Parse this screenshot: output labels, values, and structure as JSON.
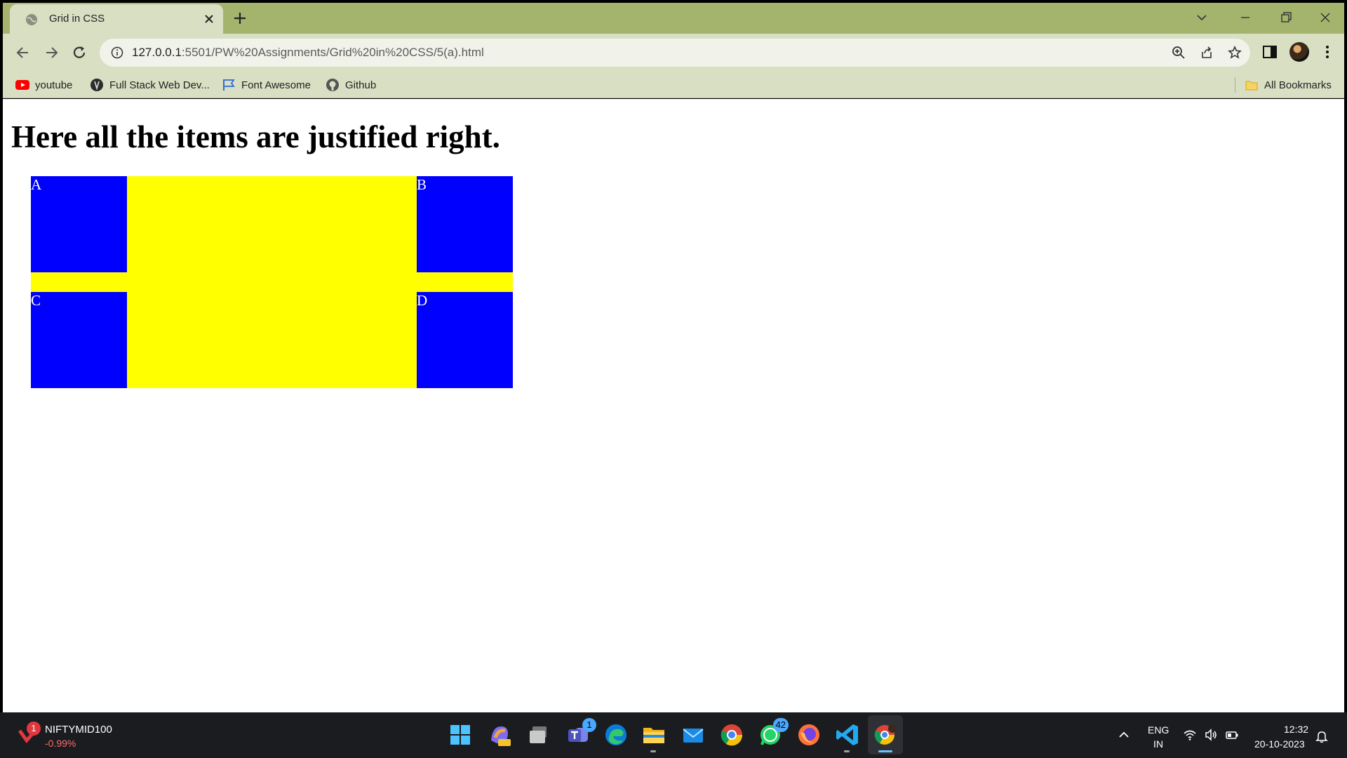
{
  "browser": {
    "tab": {
      "title": "Grid in CSS"
    },
    "omnibox": {
      "url_host": "127.0.0.1",
      "url_path": ":5501/PW%20Assignments/Grid%20in%20CSS/5(a).html"
    },
    "bookmarks": [
      {
        "label": "youtube",
        "icon": "youtube-icon"
      },
      {
        "label": "Full Stack Web Dev...",
        "icon": "site-favicon-icon"
      },
      {
        "label": "Font Awesome",
        "icon": "flag-icon"
      },
      {
        "label": "Github",
        "icon": "github-icon"
      }
    ],
    "all_bookmarks": {
      "label": "All Bookmarks",
      "icon": "folder-icon"
    },
    "colors": {
      "frame": "#a5b46d",
      "toolbar": "#d8dfc3"
    }
  },
  "page": {
    "heading": "Here all the items are justified right.",
    "grid": {
      "container_color": "#ffff00",
      "item_color": "#0000ff",
      "items": [
        "A",
        "B",
        "C",
        "D"
      ]
    }
  },
  "taskbar": {
    "ticker": {
      "name": "NIFTYMID100",
      "change": "-0.99%",
      "badge": "1"
    },
    "apps": [
      {
        "name": "start-icon"
      },
      {
        "name": "copilot-pre-icon"
      },
      {
        "name": "task-view-icon"
      },
      {
        "name": "teams-icon",
        "badge": "1"
      },
      {
        "name": "edge-icon"
      },
      {
        "name": "file-explorer-icon"
      },
      {
        "name": "mail-icon"
      },
      {
        "name": "chrome-icon"
      },
      {
        "name": "whatsapp-icon",
        "badge": "42"
      },
      {
        "name": "firefox-icon"
      },
      {
        "name": "vscode-icon"
      },
      {
        "name": "chrome-profile-icon"
      }
    ],
    "tray": {
      "lang_line1": "ENG",
      "lang_line2": "IN",
      "time": "12:32",
      "date": "20-10-2023"
    }
  }
}
